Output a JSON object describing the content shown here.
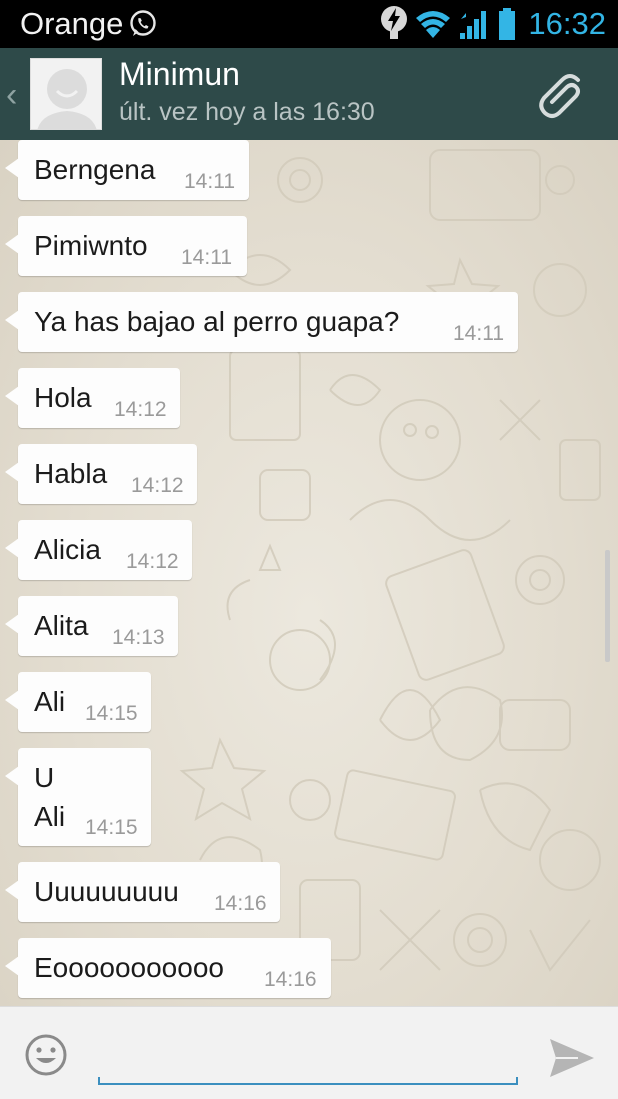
{
  "statusbar": {
    "carrier": "Orange",
    "time": "16:32"
  },
  "header": {
    "contact_name": "Minimun",
    "last_seen": "últ. vez hoy a las 16:30"
  },
  "messages": [
    {
      "text": "Berngena",
      "time": "14:11"
    },
    {
      "text": "Pimiwnto",
      "time": "14:11"
    },
    {
      "text": "Ya has bajao al perro guapa?",
      "time": "14:11"
    },
    {
      "text": "Hola",
      "time": "14:12"
    },
    {
      "text": "Habla",
      "time": "14:12"
    },
    {
      "text": "Alicia",
      "time": "14:12"
    },
    {
      "text": "Alita",
      "time": "14:13"
    },
    {
      "text": "Ali",
      "time": "14:15"
    },
    {
      "text": "U\nAli",
      "time": "14:15"
    },
    {
      "text": "Uuuuuuuuu",
      "time": "14:16"
    },
    {
      "text": "Eooooooooooo",
      "time": "14:16"
    }
  ],
  "composer": {
    "value": ""
  },
  "colors": {
    "actionbar": "#2e4a49",
    "statusbar": "#000000",
    "clock": "#33b5e5",
    "accent": "#3b8fbf"
  },
  "icons": [
    "whatsapp-icon",
    "bolt-icon",
    "wifi-icon",
    "signal-icon",
    "battery-icon",
    "back-icon",
    "avatar-icon",
    "attach-icon",
    "emoji-icon",
    "send-icon"
  ]
}
